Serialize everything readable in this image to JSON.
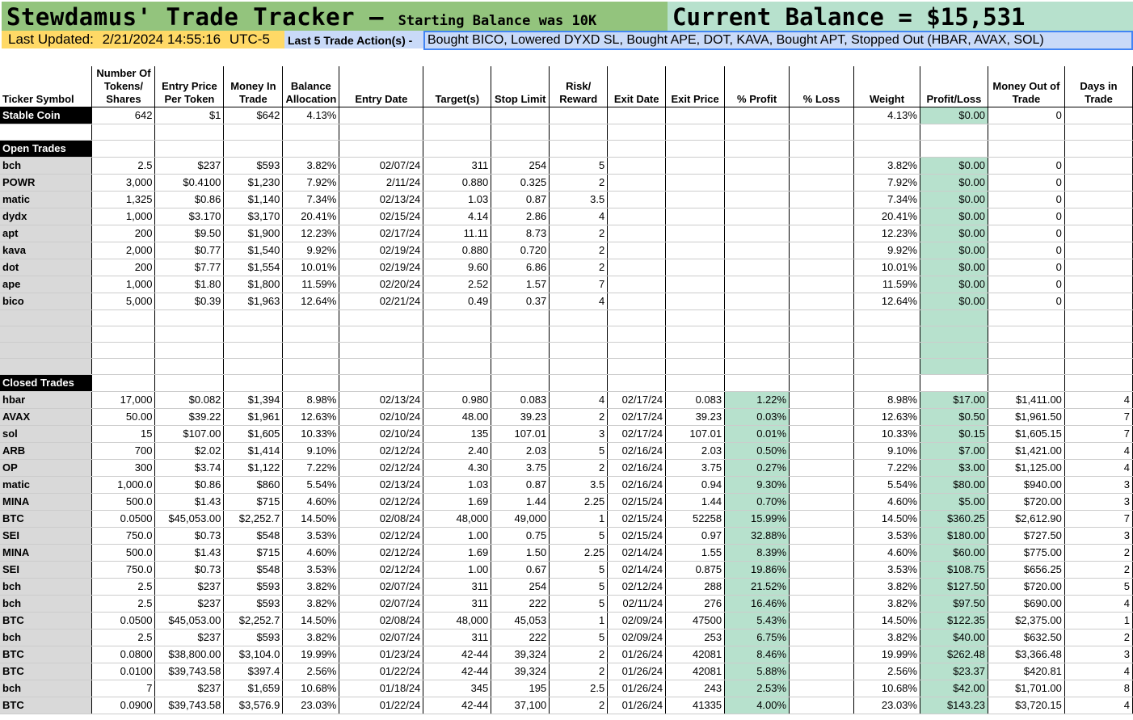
{
  "header": {
    "title": "Stewdamus' Trade Tracker –",
    "subtitle": "Starting Balance was 10K",
    "current_balance": "Current Balance = $15,531"
  },
  "status": {
    "updated_label": "Last Updated:",
    "updated_value": "2/21/2024 14:55:16",
    "timezone": "UTC-5",
    "actions_label": "Last 5 Trade Action(s) -",
    "actions_value": "Bought BICO, Lowered DYXD SL, Bought APE, DOT, KAVA, Bought APT, Stopped Out (HBAR, AVAX, SOL)"
  },
  "columns": [
    "Ticker Symbol",
    "Number Of Tokens/ Shares",
    "Entry Price Per Token",
    "Money In Trade",
    "Balance Allocation",
    "Entry Date",
    "Target(s)",
    "Stop Limit",
    "Risk/ Reward",
    "Exit Date",
    "Exit Price",
    "% Profit",
    "% Loss",
    "Weight",
    "Profit/Loss",
    "Money Out of Trade",
    "Days in Trade"
  ],
  "stable": [
    "Stable Coin",
    "642",
    "$1",
    "$642",
    "4.13%",
    "",
    "",
    "",
    "",
    "",
    "",
    "",
    "",
    "4.13%",
    "$0.00",
    "0",
    ""
  ],
  "sections": {
    "open": "Open Trades",
    "closed": "Closed Trades"
  },
  "open_trades": [
    [
      "bch",
      "2.5",
      "$237",
      "$593",
      "3.82%",
      "02/07/24",
      "311",
      "254",
      "5",
      "",
      "",
      "",
      "",
      "3.82%",
      "$0.00",
      "0",
      ""
    ],
    [
      "POWR",
      "3,000",
      "$0.4100",
      "$1,230",
      "7.92%",
      "2/11/24",
      "0.880",
      "0.325",
      "2",
      "",
      "",
      "",
      "",
      "7.92%",
      "$0.00",
      "0",
      ""
    ],
    [
      "matic",
      "1,325",
      "$0.86",
      "$1,140",
      "7.34%",
      "02/13/24",
      "1.03",
      "0.87",
      "3.5",
      "",
      "",
      "",
      "",
      "7.34%",
      "$0.00",
      "0",
      ""
    ],
    [
      "dydx",
      "1,000",
      "$3.170",
      "$3,170",
      "20.41%",
      "02/15/24",
      "4.14",
      "2.86",
      "4",
      "",
      "",
      "",
      "",
      "20.41%",
      "$0.00",
      "0",
      ""
    ],
    [
      "apt",
      "200",
      "$9.50",
      "$1,900",
      "12.23%",
      "02/17/24",
      "11.11",
      "8.73",
      "2",
      "",
      "",
      "",
      "",
      "12.23%",
      "$0.00",
      "0",
      ""
    ],
    [
      "kava",
      "2,000",
      "$0.77",
      "$1,540",
      "9.92%",
      "02/19/24",
      "0.880",
      "0.720",
      "2",
      "",
      "",
      "",
      "",
      "9.92%",
      "$0.00",
      "0",
      ""
    ],
    [
      "dot",
      "200",
      "$7.77",
      "$1,554",
      "10.01%",
      "02/19/24",
      "9.60",
      "6.86",
      "2",
      "",
      "",
      "",
      "",
      "10.01%",
      "$0.00",
      "0",
      ""
    ],
    [
      "ape",
      "1,000",
      "$1.80",
      "$1,800",
      "11.59%",
      "02/20/24",
      "2.52",
      "1.57",
      "7",
      "",
      "",
      "",
      "",
      "11.59%",
      "$0.00",
      "0",
      ""
    ],
    [
      "bico",
      "5,000",
      "$0.39",
      "$1,963",
      "12.64%",
      "02/21/24",
      "0.49",
      "0.37",
      "4",
      "",
      "",
      "",
      "",
      "12.64%",
      "$0.00",
      "0",
      ""
    ]
  ],
  "closed_trades": [
    [
      "hbar",
      "17,000",
      "$0.082",
      "$1,394",
      "8.98%",
      "02/13/24",
      "0.980",
      "0.083",
      "4",
      "02/17/24",
      "0.083",
      "1.22%",
      "",
      "8.98%",
      "$17.00",
      "$1,411.00",
      "4"
    ],
    [
      "AVAX",
      "50.00",
      "$39.22",
      "$1,961",
      "12.63%",
      "02/10/24",
      "48.00",
      "39.23",
      "2",
      "02/17/24",
      "39.23",
      "0.03%",
      "",
      "12.63%",
      "$0.50",
      "$1,961.50",
      "7"
    ],
    [
      "sol",
      "15",
      "$107.00",
      "$1,605",
      "10.33%",
      "02/10/24",
      "135",
      "107.01",
      "3",
      "02/17/24",
      "107.01",
      "0.01%",
      "",
      "10.33%",
      "$0.15",
      "$1,605.15",
      "7"
    ],
    [
      "ARB",
      "700",
      "$2.02",
      "$1,414",
      "9.10%",
      "02/12/24",
      "2.40",
      "2.03",
      "5",
      "02/16/24",
      "2.03",
      "0.50%",
      "",
      "9.10%",
      "$7.00",
      "$1,421.00",
      "4"
    ],
    [
      "OP",
      "300",
      "$3.74",
      "$1,122",
      "7.22%",
      "02/12/24",
      "4.30",
      "3.75",
      "2",
      "02/16/24",
      "3.75",
      "0.27%",
      "",
      "7.22%",
      "$3.00",
      "$1,125.00",
      "4"
    ],
    [
      "matic",
      "1,000.0",
      "$0.86",
      "$860",
      "5.54%",
      "02/13/24",
      "1.03",
      "0.87",
      "3.5",
      "02/16/24",
      "0.94",
      "9.30%",
      "",
      "5.54%",
      "$80.00",
      "$940.00",
      "3"
    ],
    [
      "MINA",
      "500.0",
      "$1.43",
      "$715",
      "4.60%",
      "02/12/24",
      "1.69",
      "1.44",
      "2.25",
      "02/15/24",
      "1.44",
      "0.70%",
      "",
      "4.60%",
      "$5.00",
      "$720.00",
      "3"
    ],
    [
      "BTC",
      "0.0500",
      "$45,053.00",
      "$2,252.7",
      "14.50%",
      "02/08/24",
      "48,000",
      "49,000",
      "1",
      "02/15/24",
      "52258",
      "15.99%",
      "",
      "14.50%",
      "$360.25",
      "$2,612.90",
      "7"
    ],
    [
      "SEI",
      "750.0",
      "$0.73",
      "$548",
      "3.53%",
      "02/12/24",
      "1.00",
      "0.75",
      "5",
      "02/15/24",
      "0.97",
      "32.88%",
      "",
      "3.53%",
      "$180.00",
      "$727.50",
      "3"
    ],
    [
      "MINA",
      "500.0",
      "$1.43",
      "$715",
      "4.60%",
      "02/12/24",
      "1.69",
      "1.50",
      "2.25",
      "02/14/24",
      "1.55",
      "8.39%",
      "",
      "4.60%",
      "$60.00",
      "$775.00",
      "2"
    ],
    [
      "SEI",
      "750.0",
      "$0.73",
      "$548",
      "3.53%",
      "02/12/24",
      "1.00",
      "0.67",
      "5",
      "02/14/24",
      "0.875",
      "19.86%",
      "",
      "3.53%",
      "$108.75",
      "$656.25",
      "2"
    ],
    [
      "bch",
      "2.5",
      "$237",
      "$593",
      "3.82%",
      "02/07/24",
      "311",
      "254",
      "5",
      "02/12/24",
      "288",
      "21.52%",
      "",
      "3.82%",
      "$127.50",
      "$720.00",
      "5"
    ],
    [
      "bch",
      "2.5",
      "$237",
      "$593",
      "3.82%",
      "02/07/24",
      "311",
      "222",
      "5",
      "02/11/24",
      "276",
      "16.46%",
      "",
      "3.82%",
      "$97.50",
      "$690.00",
      "4"
    ],
    [
      "BTC",
      "0.0500",
      "$45,053.00",
      "$2,252.7",
      "14.50%",
      "02/08/24",
      "48,000",
      "45,053",
      "1",
      "02/09/24",
      "47500",
      "5.43%",
      "",
      "14.50%",
      "$122.35",
      "$2,375.00",
      "1"
    ],
    [
      "bch",
      "2.5",
      "$237",
      "$593",
      "3.82%",
      "02/07/24",
      "311",
      "222",
      "5",
      "02/09/24",
      "253",
      "6.75%",
      "",
      "3.82%",
      "$40.00",
      "$632.50",
      "2"
    ],
    [
      "BTC",
      "0.0800",
      "$38,800.00",
      "$3,104.0",
      "19.99%",
      "01/23/24",
      "42-44",
      "39,324",
      "2",
      "01/26/24",
      "42081",
      "8.46%",
      "",
      "19.99%",
      "$262.48",
      "$3,366.48",
      "3"
    ],
    [
      "BTC",
      "0.0100",
      "$39,743.58",
      "$397.4",
      "2.56%",
      "01/22/24",
      "42-44",
      "39,324",
      "2",
      "01/26/24",
      "42081",
      "5.88%",
      "",
      "2.56%",
      "$23.37",
      "$420.81",
      "4"
    ],
    [
      "bch",
      "7",
      "$237",
      "$1,659",
      "10.68%",
      "01/18/24",
      "345",
      "195",
      "2.5",
      "01/26/24",
      "243",
      "2.53%",
      "",
      "10.68%",
      "$42.00",
      "$1,701.00",
      "8"
    ],
    [
      "BTC",
      "0.0900",
      "$39,743.58",
      "$3,576.9",
      "23.03%",
      "01/22/24",
      "42-44",
      "37,100",
      "2",
      "01/26/24",
      "41335",
      "4.00%",
      "",
      "23.03%",
      "$143.23",
      "$3,720.15",
      "4"
    ]
  ]
}
